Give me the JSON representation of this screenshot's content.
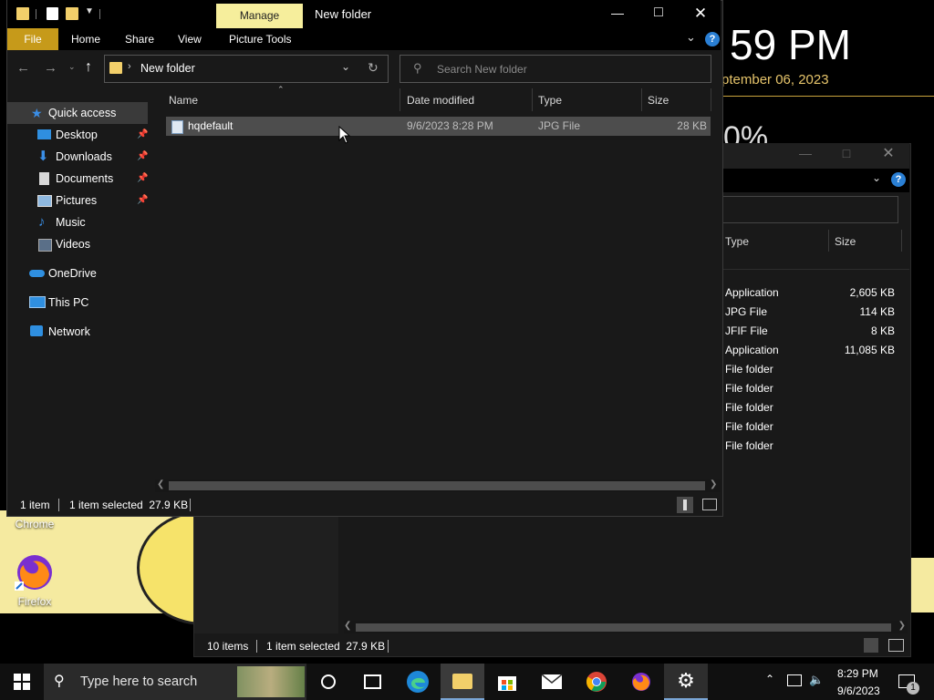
{
  "desktop": {
    "clock_partial": "59 PM",
    "date_partial": "ptember 06, 2023",
    "percent_partial": "0%",
    "icons": [
      {
        "label": "Chrome"
      },
      {
        "label": "Firefox"
      }
    ]
  },
  "back_window": {
    "columns": {
      "type": "Type",
      "size": "Size"
    },
    "rows": [
      {
        "type": "Application",
        "size": "2,605 KB"
      },
      {
        "type": "JPG File",
        "size": "114 KB"
      },
      {
        "type": "JFIF File",
        "size": "8 KB"
      },
      {
        "type": "Application",
        "size": "11,085 KB"
      },
      {
        "type": "File folder",
        "size": ""
      },
      {
        "type": "File folder",
        "size": ""
      },
      {
        "type": "File folder",
        "size": ""
      },
      {
        "type": "File folder",
        "size": ""
      },
      {
        "type": "File folder",
        "size": ""
      }
    ],
    "status": {
      "count": "10 items",
      "selected": "1 item selected  27.9 KB"
    }
  },
  "explorer": {
    "title": "New folder",
    "context_tab": "Manage",
    "ribbon_tabs": {
      "file": "File",
      "home": "Home",
      "share": "Share",
      "view": "View",
      "picture_tools": "Picture Tools"
    },
    "address": {
      "path": "New folder"
    },
    "search": {
      "placeholder": "Search New folder"
    },
    "nav": {
      "quick_access": "Quick access",
      "desktop": "Desktop",
      "downloads": "Downloads",
      "documents": "Documents",
      "pictures": "Pictures",
      "music": "Music",
      "videos": "Videos",
      "onedrive": "OneDrive",
      "this_pc": "This PC",
      "network": "Network"
    },
    "columns": {
      "name": "Name",
      "date": "Date modified",
      "type": "Type",
      "size": "Size"
    },
    "files": [
      {
        "name": "hqdefault",
        "date": "9/6/2023 8:28 PM",
        "type": "JPG File",
        "size": "28 KB"
      }
    ],
    "status": {
      "count": "1 item",
      "selected": "1 item selected  27.9 KB"
    }
  },
  "taskbar": {
    "search_placeholder": "Type here to search",
    "time": "8:29 PM",
    "date": "9/6/2023",
    "notification_count": "1"
  },
  "colors": {
    "selection": "#4d4d4d",
    "accent_file_tab": "#c69a1a",
    "context_tab": "#f6ee9c",
    "folder": "#f2cf6a"
  }
}
